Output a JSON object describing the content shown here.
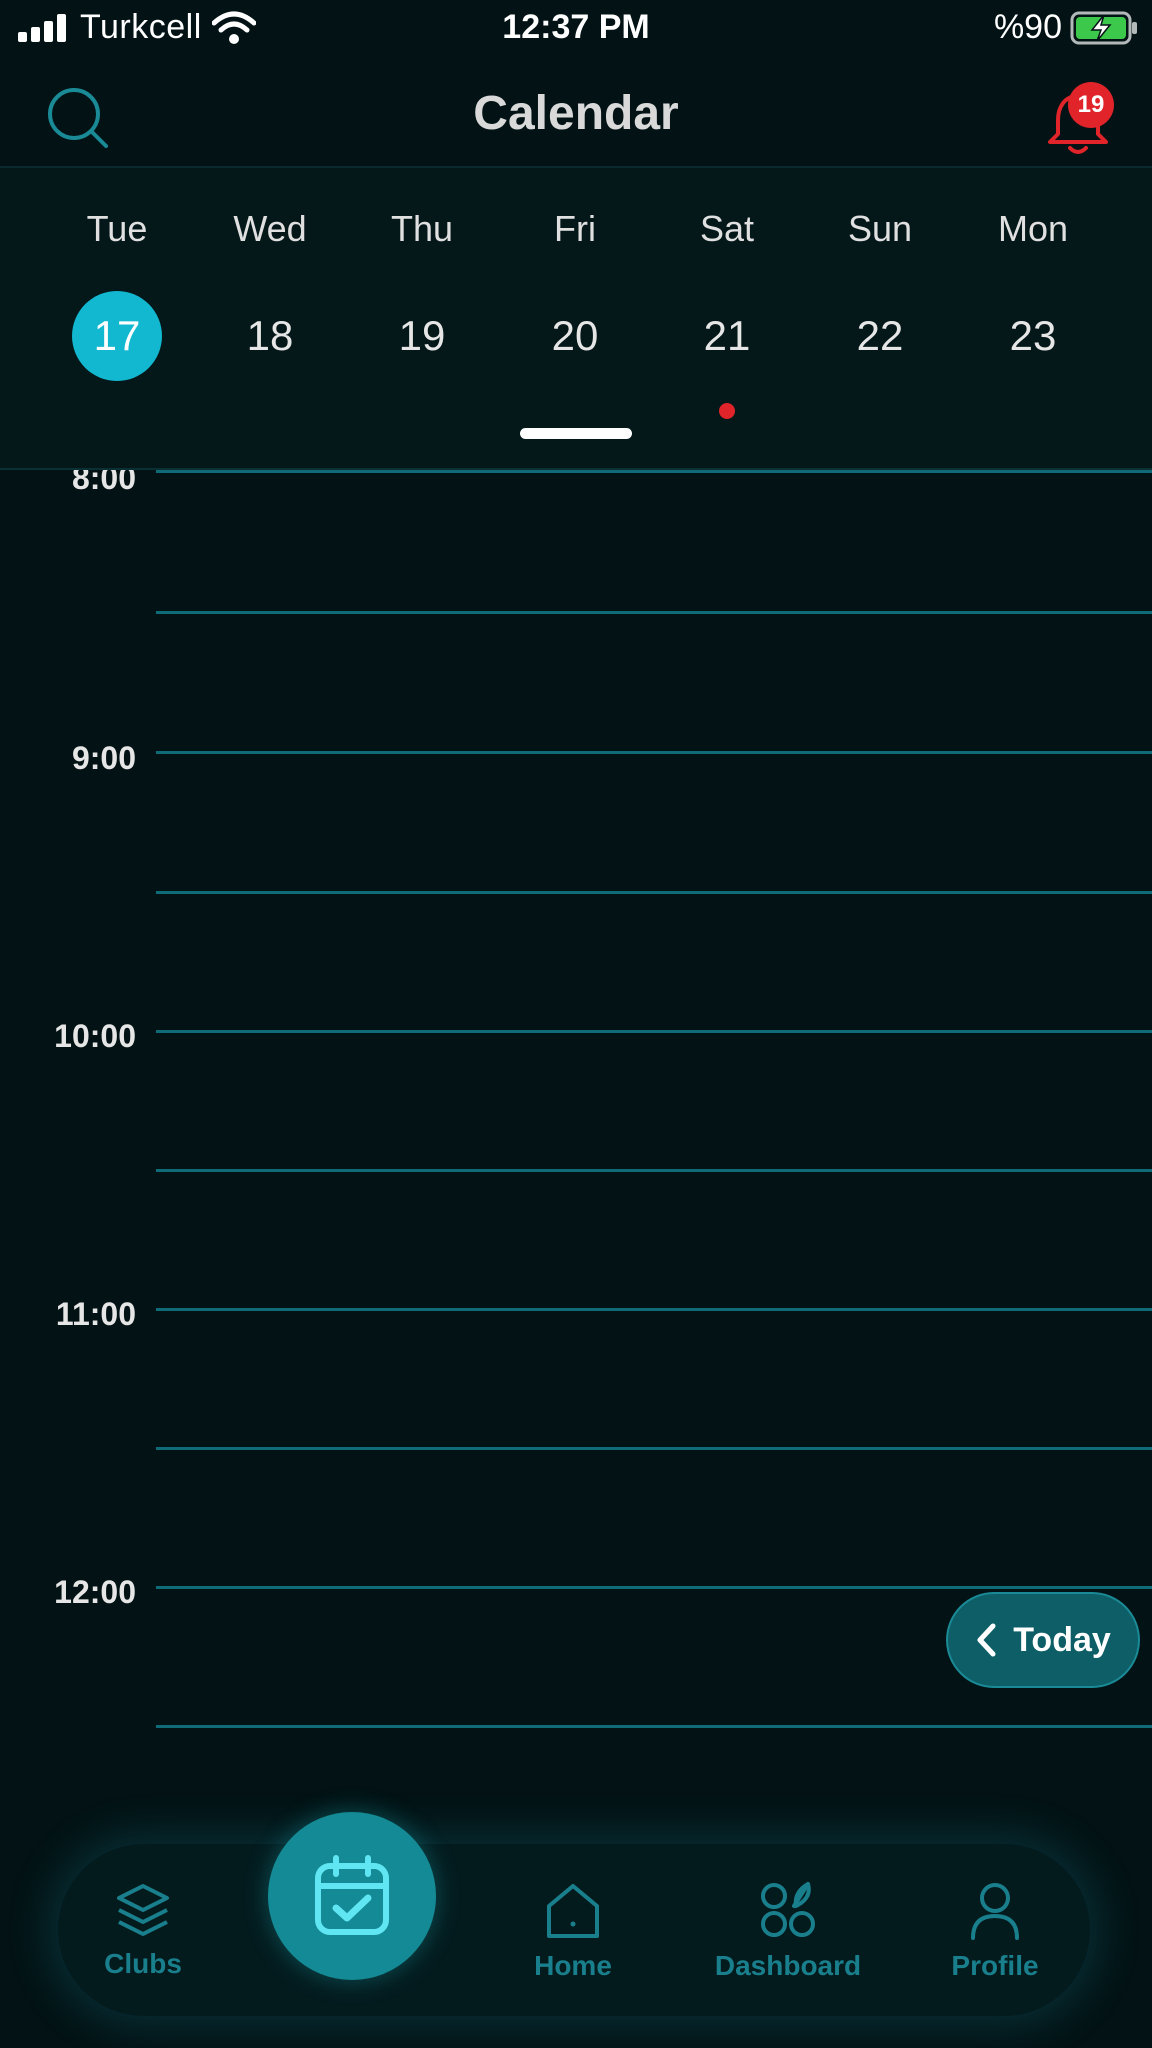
{
  "status_bar": {
    "carrier": "Turkcell",
    "time": "12:37 PM",
    "battery": "%90"
  },
  "header": {
    "title": "Calendar",
    "notification_count": "19"
  },
  "week": {
    "days": [
      {
        "name": "Tue",
        "date": "17",
        "selected": true,
        "has_event": false
      },
      {
        "name": "Wed",
        "date": "18",
        "selected": false,
        "has_event": false
      },
      {
        "name": "Thu",
        "date": "19",
        "selected": false,
        "has_event": false
      },
      {
        "name": "Fri",
        "date": "20",
        "selected": false,
        "has_event": false
      },
      {
        "name": "Sat",
        "date": "21",
        "selected": false,
        "has_event": true
      },
      {
        "name": "Sun",
        "date": "22",
        "selected": false,
        "has_event": false
      },
      {
        "name": "Mon",
        "date": "23",
        "selected": false,
        "has_event": false
      }
    ]
  },
  "timeline": {
    "hours": [
      "8:00",
      "9:00",
      "10:00",
      "11:00",
      "12:00"
    ]
  },
  "today_button": {
    "label": "Today"
  },
  "nav": {
    "items": [
      {
        "label": "Clubs",
        "icon": "layers-icon"
      },
      {
        "label": "",
        "icon": "calendar-check-icon"
      },
      {
        "label": "Home",
        "icon": "home-icon"
      },
      {
        "label": "Dashboard",
        "icon": "dashboard-icon"
      },
      {
        "label": "Profile",
        "icon": "profile-icon"
      }
    ]
  },
  "colors": {
    "background": "#031315",
    "accent": "#12b8d0",
    "grid_line": "#0f6b78",
    "badge": "#e0242a",
    "nav_label": "#1a7f8c"
  }
}
